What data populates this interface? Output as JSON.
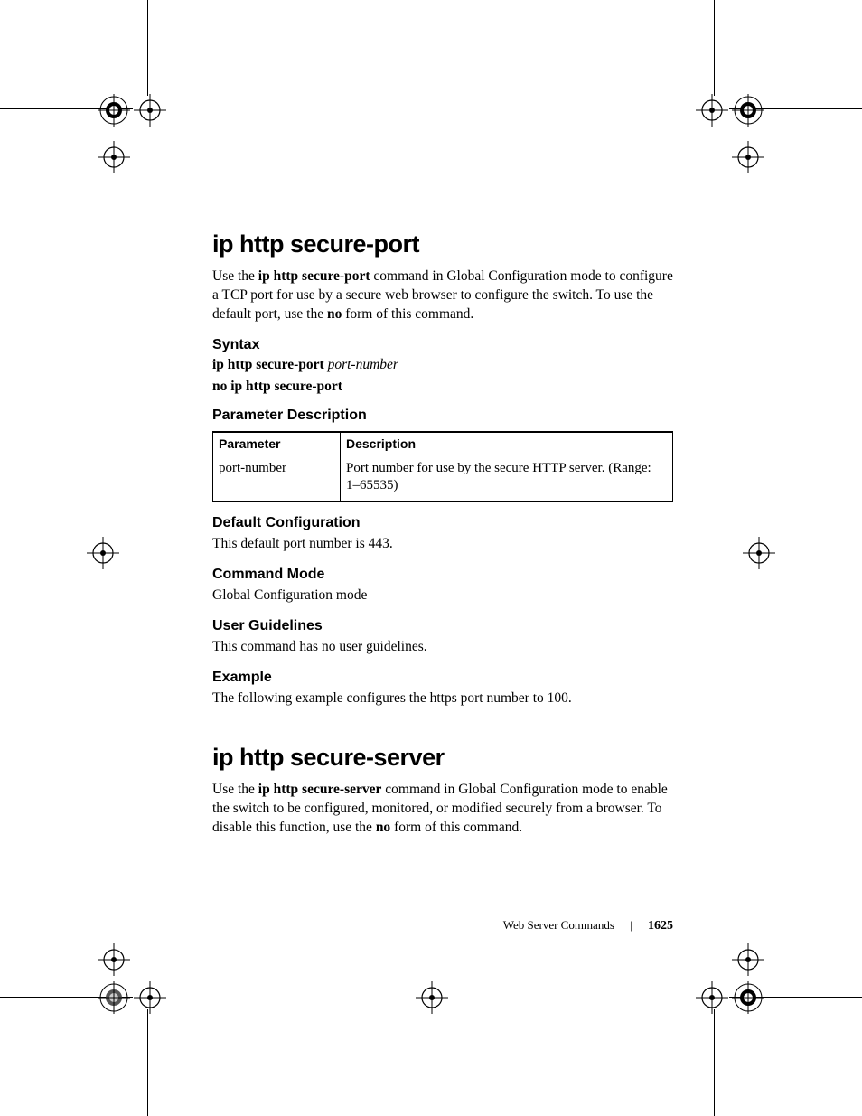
{
  "section1": {
    "title": "ip http secure-port",
    "intro_pre": "Use the ",
    "intro_cmd": "ip http secure-port",
    "intro_mid": " command in Global Configuration mode to configure a TCP port for use by a secure web browser to configure the switch. To use the default port, use the ",
    "intro_no": "no",
    "intro_post": " form of this command.",
    "syntax_h": "Syntax",
    "syntax_cmd": "ip http secure-port",
    "syntax_arg": "port-number",
    "syntax_no": "no ip http secure-port",
    "paramdesc_h": "Parameter Description",
    "table": {
      "h_param": "Parameter",
      "h_desc": "Description",
      "r_param": "port-number",
      "r_desc": "Port number for use by the secure HTTP server. (Range: 1–65535)"
    },
    "default_h": "Default Configuration",
    "default_body": "This default port number is 443.",
    "mode_h": "Command Mode",
    "mode_body": "Global Configuration mode",
    "guide_h": "User Guidelines",
    "guide_body": "This command has no user guidelines.",
    "example_h": "Example",
    "example_body": "The following example configures the https port number to 100."
  },
  "section2": {
    "title": "ip http secure-server",
    "intro_pre": "Use the ",
    "intro_cmd": "ip http secure-server",
    "intro_mid": " command in Global Configuration mode to enable the switch to be configured, monitored, or modified securely from a browser. To disable this function, use the ",
    "intro_no": "no",
    "intro_post": " form of this command."
  },
  "footer": {
    "section": "Web Server Commands",
    "page": "1625"
  }
}
